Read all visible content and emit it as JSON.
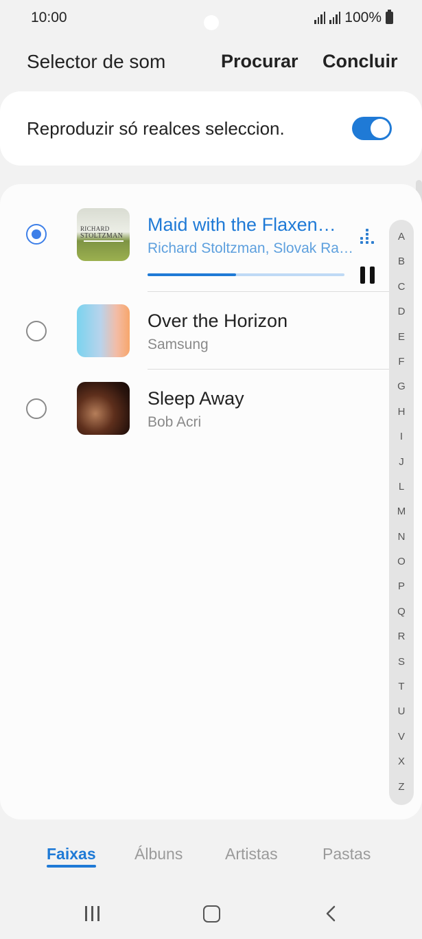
{
  "status_bar": {
    "time": "10:00",
    "battery": "100%"
  },
  "header": {
    "title": "Selector de som",
    "search_label": "Procurar",
    "done_label": "Concluir"
  },
  "highlights": {
    "label": "Reproduzir só realces seleccion.",
    "enabled": true
  },
  "tracks": [
    {
      "title": "Maid with the Flaxen…",
      "artist": "Richard Stoltzman, Slovak Ra…",
      "selected": true,
      "playing": true,
      "progress": 0.45,
      "art_text_1": "RICHARD",
      "art_text_2": "STOLTZMAN"
    },
    {
      "title": "Over the Horizon",
      "artist": "Samsung",
      "selected": false
    },
    {
      "title": "Sleep Away",
      "artist": "Bob Acri",
      "selected": false
    }
  ],
  "index_letters": [
    "A",
    "B",
    "C",
    "D",
    "E",
    "F",
    "G",
    "H",
    "I",
    "J",
    "L",
    "M",
    "N",
    "O",
    "P",
    "Q",
    "R",
    "S",
    "T",
    "U",
    "V",
    "X",
    "Z"
  ],
  "tabs": [
    {
      "label": "Faixas",
      "active": true
    },
    {
      "label": "Álbuns",
      "active": false
    },
    {
      "label": "Artistas",
      "active": false
    },
    {
      "label": "Pastas",
      "active": false
    }
  ],
  "colors": {
    "accent": "#1f7ad6",
    "background": "#f2f2f2",
    "card": "#fcfcfc"
  }
}
